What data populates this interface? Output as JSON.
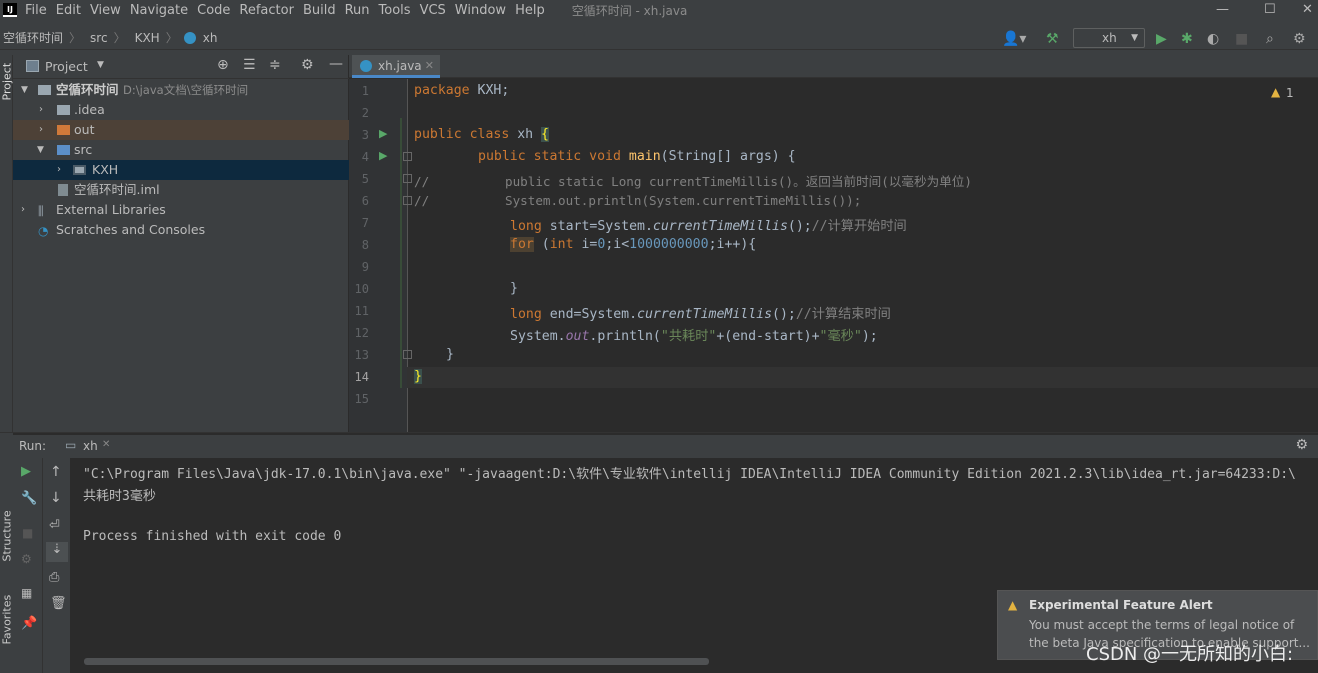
{
  "menubar": {
    "items": [
      "File",
      "Edit",
      "View",
      "Navigate",
      "Code",
      "Refactor",
      "Build",
      "Run",
      "Tools",
      "VCS",
      "Window",
      "Help"
    ],
    "title": "空循环时间 - xh.java"
  },
  "navbar": {
    "breadcrumbs": [
      "空循环时间",
      "src",
      "KXH",
      "xh"
    ],
    "run_config": "xh"
  },
  "project": {
    "header": "Project",
    "root_name": "空循环时间",
    "root_path": "D:\\java文档\\空循环时间",
    "items": [
      ".idea",
      "out",
      "src",
      "KXH",
      "空循环时间.iml",
      "External Libraries",
      "Scratches and Consoles"
    ]
  },
  "side_tabs": {
    "project": "Project",
    "structure": "Structure",
    "favorites": "Favorites"
  },
  "editor": {
    "tab": "xh.java",
    "warning_count": "1",
    "line_numbers": [
      "1",
      "2",
      "3",
      "4",
      "5",
      "6",
      "7",
      "8",
      "9",
      "10",
      "11",
      "12",
      "13",
      "14",
      "15"
    ]
  },
  "code": {
    "l1_kw": "package",
    "l1_rest": " KXH;",
    "l3_kw": "public class",
    "l3_name": " xh ",
    "l3_brace": "{",
    "l4_kw": "public static void",
    "l4_fn": "main",
    "l4_rest": "(String[] args) {",
    "l5": "//          public static Long currentTimeMillis()。返回当前时间(以毫秒为单位)",
    "l6": "//          System.out.println(System.currentTimeMillis());",
    "l7_kw": "long",
    "l7_a": " start=System.",
    "l7_b": "currentTimeMillis",
    "l7_c": "();",
    "l7_cmt": "//计算开始时间",
    "l8_kw": "for",
    "l8_a": " (",
    "l8_kw2": "int",
    "l8_b": " i=",
    "l8_n0": "0",
    "l8_c": ";i<",
    "l8_n1": "1000000000",
    "l8_d": ";i++){",
    "l10": "}",
    "l11_kw": "long",
    "l11_a": " end=System.",
    "l11_b": "currentTimeMillis",
    "l11_c": "();",
    "l11_cmt": "//计算结束时间",
    "l12_a": "System.",
    "l12_field": "out",
    "l12_b": ".println(",
    "l12_s1": "\"共耗时\"",
    "l12_c": "+(end-start)+",
    "l12_s2": "\"毫秒\"",
    "l12_d": ");",
    "l13": "}",
    "l14": "}"
  },
  "run": {
    "label": "Run:",
    "tab": "xh",
    "cmd": "\"C:\\Program Files\\Java\\jdk-17.0.1\\bin\\java.exe\" \"-javaagent:D:\\软件\\专业软件\\intellij IDEA\\IntelliJ IDEA Community Edition 2021.2.3\\lib\\idea_rt.jar=64233:D:\\",
    "output": "共耗时3毫秒",
    "exit": "Process finished with exit code 0"
  },
  "notification": {
    "title": "Experimental Feature Alert",
    "line1": "You must accept the terms of legal notice of",
    "line2": "the beta Java specification to enable support..."
  },
  "watermark": "CSDN @一无所知的小白:",
  "colors": {
    "accent": "#4a88c7",
    "keyword": "#cc7832",
    "string": "#6a8759",
    "number": "#6897bb",
    "comment": "#808080"
  }
}
